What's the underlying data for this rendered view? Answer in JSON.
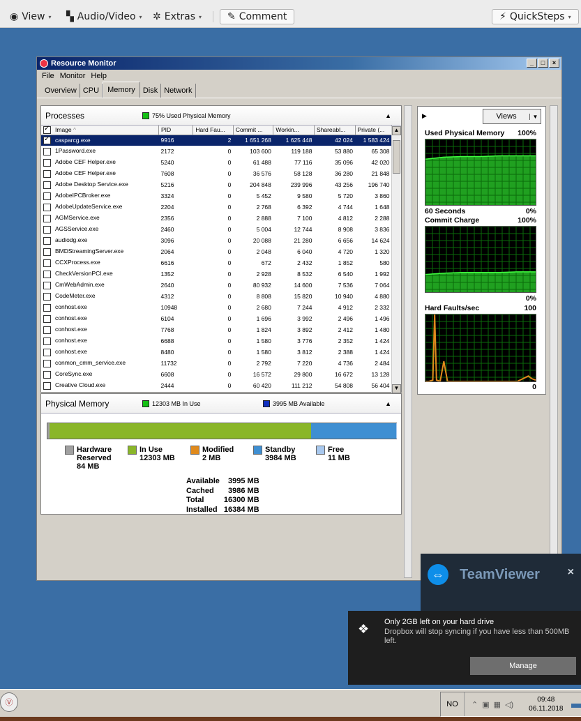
{
  "toolbar": {
    "view": "View",
    "audio_video": "Audio/Video",
    "extras": "Extras",
    "comment": "Comment",
    "quicksteps": "QuickSteps"
  },
  "window": {
    "title": "Resource Monitor",
    "menu": [
      "File",
      "Monitor",
      "Help"
    ],
    "tabs": [
      "Overview",
      "CPU",
      "Memory",
      "Disk",
      "Network"
    ],
    "active_tab": "Memory"
  },
  "processes": {
    "title": "Processes",
    "legend": "75% Used Physical Memory",
    "columns": [
      "Image",
      "PID",
      "Hard Fau...",
      "Commit ...",
      "Workin...",
      "Shareabl...",
      "Private (..."
    ],
    "rows": [
      {
        "image": "casparcg.exe",
        "pid": "9916",
        "hf": "2",
        "commit": "1 651 268",
        "ws": "1 625 448",
        "sh": "42 024",
        "pr": "1 583 424",
        "checked": true,
        "selected": true
      },
      {
        "image": "1Password.exe",
        "pid": "2172",
        "hf": "0",
        "commit": "103 600",
        "ws": "119 188",
        "sh": "53 880",
        "pr": "65 308"
      },
      {
        "image": "Adobe CEF Helper.exe",
        "pid": "5240",
        "hf": "0",
        "commit": "61 488",
        "ws": "77 116",
        "sh": "35 096",
        "pr": "42 020"
      },
      {
        "image": "Adobe CEF Helper.exe",
        "pid": "7608",
        "hf": "0",
        "commit": "36 576",
        "ws": "58 128",
        "sh": "36 280",
        "pr": "21 848"
      },
      {
        "image": "Adobe Desktop Service.exe",
        "pid": "5216",
        "hf": "0",
        "commit": "204 848",
        "ws": "239 996",
        "sh": "43 256",
        "pr": "196 740"
      },
      {
        "image": "AdobeIPCBroker.exe",
        "pid": "3324",
        "hf": "0",
        "commit": "5 452",
        "ws": "9 580",
        "sh": "5 720",
        "pr": "3 860"
      },
      {
        "image": "AdobeUpdateService.exe",
        "pid": "2204",
        "hf": "0",
        "commit": "2 768",
        "ws": "6 392",
        "sh": "4 744",
        "pr": "1 648"
      },
      {
        "image": "AGMService.exe",
        "pid": "2356",
        "hf": "0",
        "commit": "2 888",
        "ws": "7 100",
        "sh": "4 812",
        "pr": "2 288"
      },
      {
        "image": "AGSService.exe",
        "pid": "2460",
        "hf": "0",
        "commit": "5 004",
        "ws": "12 744",
        "sh": "8 908",
        "pr": "3 836"
      },
      {
        "image": "audiodg.exe",
        "pid": "3096",
        "hf": "0",
        "commit": "20 088",
        "ws": "21 280",
        "sh": "6 656",
        "pr": "14 624"
      },
      {
        "image": "BMDStreamingServer.exe",
        "pid": "2064",
        "hf": "0",
        "commit": "2 048",
        "ws": "6 040",
        "sh": "4 720",
        "pr": "1 320"
      },
      {
        "image": "CCXProcess.exe",
        "pid": "6616",
        "hf": "0",
        "commit": "672",
        "ws": "2 432",
        "sh": "1 852",
        "pr": "580"
      },
      {
        "image": "CheckVersionPCI.exe",
        "pid": "1352",
        "hf": "0",
        "commit": "2 928",
        "ws": "8 532",
        "sh": "6 540",
        "pr": "1 992"
      },
      {
        "image": "CmWebAdmin.exe",
        "pid": "2640",
        "hf": "0",
        "commit": "80 932",
        "ws": "14 600",
        "sh": "7 536",
        "pr": "7 064"
      },
      {
        "image": "CodeMeter.exe",
        "pid": "4312",
        "hf": "0",
        "commit": "8 808",
        "ws": "15 820",
        "sh": "10 940",
        "pr": "4 880"
      },
      {
        "image": "conhost.exe",
        "pid": "10948",
        "hf": "0",
        "commit": "2 680",
        "ws": "7 244",
        "sh": "4 912",
        "pr": "2 332"
      },
      {
        "image": "conhost.exe",
        "pid": "6104",
        "hf": "0",
        "commit": "1 696",
        "ws": "3 992",
        "sh": "2 496",
        "pr": "1 496"
      },
      {
        "image": "conhost.exe",
        "pid": "7768",
        "hf": "0",
        "commit": "1 824",
        "ws": "3 892",
        "sh": "2 412",
        "pr": "1 480"
      },
      {
        "image": "conhost.exe",
        "pid": "6688",
        "hf": "0",
        "commit": "1 580",
        "ws": "3 776",
        "sh": "2 352",
        "pr": "1 424"
      },
      {
        "image": "conhost.exe",
        "pid": "8480",
        "hf": "0",
        "commit": "1 580",
        "ws": "3 812",
        "sh": "2 388",
        "pr": "1 424"
      },
      {
        "image": "conmon_cmm_service.exe",
        "pid": "11732",
        "hf": "0",
        "commit": "2 792",
        "ws": "7 220",
        "sh": "4 736",
        "pr": "2 484"
      },
      {
        "image": "CoreSync.exe",
        "pid": "6608",
        "hf": "0",
        "commit": "16 572",
        "ws": "29 800",
        "sh": "16 672",
        "pr": "13 128"
      },
      {
        "image": "Creative Cloud.exe",
        "pid": "2444",
        "hf": "0",
        "commit": "60 420",
        "ws": "111 212",
        "sh": "54 808",
        "pr": "56 404"
      }
    ]
  },
  "physical_memory": {
    "title": "Physical Memory",
    "in_use_legend": "12303 MB In Use",
    "available_legend": "3995 MB Available",
    "bar": {
      "hardware_reserved_mb": 84,
      "in_use_mb": 12303,
      "modified_mb": 2,
      "standby_mb": 3984,
      "free_mb": 11
    },
    "legend": [
      {
        "label": "Hardware Reserved",
        "value": "84 MB",
        "color": "#a0a0a0"
      },
      {
        "label": "In Use",
        "value": "12303 MB",
        "color": "#8ab629"
      },
      {
        "label": "Modified",
        "value": "2 MB",
        "color": "#e08a1c"
      },
      {
        "label": "Standby",
        "value": "3984 MB",
        "color": "#3f8fd2"
      },
      {
        "label": "Free",
        "value": "11 MB",
        "color": "#a8c8ee"
      }
    ],
    "totals": [
      {
        "label": "Available",
        "value": "3995 MB"
      },
      {
        "label": "Cached",
        "value": "3986 MB"
      },
      {
        "label": "Total",
        "value": "16300 MB"
      },
      {
        "label": "Installed",
        "value": "16384 MB"
      }
    ]
  },
  "graphs": {
    "views_label": "Views",
    "used_physical": {
      "title": "Used Physical Memory",
      "max": "100%",
      "min_label": "60 Seconds",
      "min": "0%"
    },
    "commit_charge": {
      "title": "Commit Charge",
      "max": "100%",
      "min": "0%"
    },
    "hard_faults": {
      "title": "Hard Faults/sec",
      "max": "100",
      "min": "0"
    }
  },
  "chart_data": [
    {
      "type": "area",
      "title": "Used Physical Memory",
      "ylim": [
        0,
        100
      ],
      "x": [
        0,
        10,
        20,
        30,
        40,
        50,
        60
      ],
      "values": [
        70,
        73,
        74,
        74,
        75,
        75,
        75
      ]
    },
    {
      "type": "area",
      "title": "Commit Charge",
      "ylim": [
        0,
        100
      ],
      "x": [
        0,
        10,
        20,
        30,
        40,
        50,
        60
      ],
      "values": [
        27,
        29,
        30,
        30,
        30,
        31,
        31
      ]
    },
    {
      "type": "line",
      "title": "Hard Faults/sec",
      "ylim": [
        0,
        100
      ],
      "x": [
        0,
        2,
        4,
        5,
        6,
        8,
        10,
        12,
        14,
        16,
        18,
        20,
        30,
        40,
        50,
        56,
        58,
        60
      ],
      "values": [
        0,
        0,
        2,
        100,
        2,
        0,
        30,
        0,
        0,
        0,
        0,
        0,
        0,
        0,
        0,
        8,
        4,
        2
      ]
    }
  ],
  "teamviewer": {
    "name": "TeamViewer",
    "close": "×"
  },
  "toast": {
    "title": "Only 2GB left on your hard drive",
    "body": "Dropbox will stop syncing if you have less than 500MB left.",
    "button": "Manage"
  },
  "taskbar": {
    "lang": "NO",
    "time": "09:48",
    "date": "06.11.2018"
  }
}
